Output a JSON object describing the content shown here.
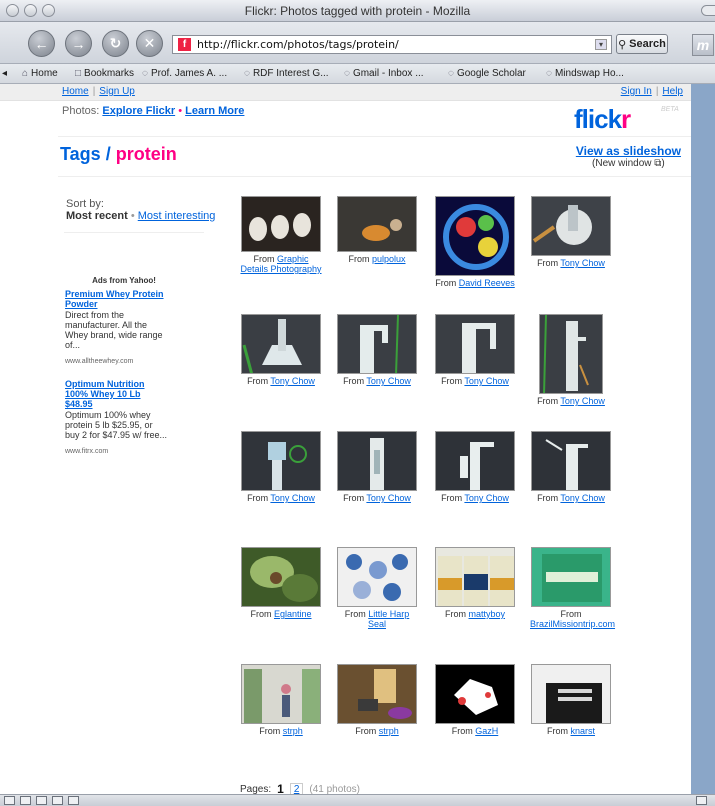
{
  "window": {
    "title": "Flickr: Photos tagged with protein - Mozilla"
  },
  "toolbar": {
    "url": "http://flickr.com/photos/tags/protein/",
    "search_label": "Search",
    "icons": [
      "back-icon",
      "forward-icon",
      "reload-icon",
      "stop-icon"
    ]
  },
  "bookmarks": [
    {
      "label": "Home",
      "icon": "house-icon"
    },
    {
      "label": "Bookmarks",
      "icon": "folder-icon"
    },
    {
      "label": "Prof. James A. ...",
      "icon": "bookmark-icon"
    },
    {
      "label": "RDF Interest G...",
      "icon": "bookmark-icon"
    },
    {
      "label": "Gmail - Inbox ...",
      "icon": "bookmark-icon"
    },
    {
      "label": "Google Scholar",
      "icon": "bookmark-icon"
    },
    {
      "label": "Mindswap Ho...",
      "icon": "bookmark-icon"
    }
  ],
  "topnav": {
    "home": "Home",
    "signup": "Sign Up",
    "signin": "Sign In",
    "help": "Help"
  },
  "subnav": {
    "prefix": "Photos:",
    "explore": "Explore Flickr",
    "dot": "•",
    "learn": "Learn More"
  },
  "logo": {
    "blue": "flick",
    "pink": "r",
    "beta": "BETA"
  },
  "title": {
    "tags": "Tags",
    "slash": "/",
    "tag": "protein"
  },
  "slideshow": {
    "label": "View as slideshow",
    "new_window": "(New window ⧉)"
  },
  "sort": {
    "label": "Sort by:",
    "current": "Most recent",
    "dot": "•",
    "alt": "Most interesting"
  },
  "ads": {
    "header": "Ads from Yahoo!",
    "items": [
      {
        "title": "Premium Whey Protein Powder",
        "desc": "Direct from the manufacturer. All the Whey brand, wide range of...",
        "url": "www.alltheewhey.com"
      },
      {
        "title": "Optimum Nutrition 100% Whey 10 Lb $48.95",
        "desc": "Optimum 100% whey protein 5 lb $25.95, or buy 2 for $47.95 w/ free...",
        "url": "www.fitrx.com"
      }
    ]
  },
  "photos": [
    {
      "from": "From",
      "author": "Graphic Details Photography",
      "colors": [
        "#2a2420",
        "#e8e4dc"
      ]
    },
    {
      "from": "From",
      "author": "pulpolux",
      "colors": [
        "#3a3834",
        "#d88a30"
      ]
    },
    {
      "from": "From",
      "author": "David Reeves",
      "colors": [
        "#0a0a3a",
        "#e8d23a"
      ]
    },
    {
      "from": "From",
      "author": "Tony Chow",
      "colors": [
        "#3e4248",
        "#e0e4e4"
      ]
    },
    {
      "from": "From",
      "author": "Tony Chow",
      "colors": [
        "#3a3e44",
        "#dfe8ea"
      ]
    },
    {
      "from": "From",
      "author": "Tony Chow",
      "colors": [
        "#3a3e44",
        "#e4ecec"
      ]
    },
    {
      "from": "From",
      "author": "Tony Chow",
      "colors": [
        "#3a3e44",
        "#e6ecec"
      ]
    },
    {
      "from": "From",
      "author": "Tony Chow",
      "colors": [
        "#3a3e44",
        "#e0e6e6"
      ]
    },
    {
      "from": "From",
      "author": "Tony Chow",
      "colors": [
        "#30343a",
        "#d8e2e6"
      ]
    },
    {
      "from": "From",
      "author": "Tony Chow",
      "colors": [
        "#30343a",
        "#e4eaea"
      ]
    },
    {
      "from": "From",
      "author": "Tony Chow",
      "colors": [
        "#2e3238",
        "#e8eeee"
      ]
    },
    {
      "from": "From",
      "author": "Tony Chow",
      "colors": [
        "#2e3238",
        "#e6ecec"
      ]
    },
    {
      "from": "From",
      "author": "Eglantine",
      "colors": [
        "#3e5a28",
        "#9ab86a"
      ]
    },
    {
      "from": "From",
      "author": "Little Harp Seal",
      "colors": [
        "#f0f0f0",
        "#3a6ab0"
      ]
    },
    {
      "from": "From",
      "author": "mattyboy",
      "colors": [
        "#1a3a6a",
        "#e8e4c8"
      ]
    },
    {
      "from": "From",
      "author": "BrazilMissiontrip.com",
      "colors": [
        "#3ab48a",
        "#e0f0d8"
      ]
    },
    {
      "from": "From",
      "author": "strph",
      "colors": [
        "#d8d8d0",
        "#7a9a6a"
      ]
    },
    {
      "from": "From",
      "author": "strph",
      "colors": [
        "#6a5030",
        "#e0c080"
      ]
    },
    {
      "from": "From",
      "author": "GazH",
      "colors": [
        "#000000",
        "#ffffff"
      ]
    },
    {
      "from": "From",
      "author": "knarst",
      "colors": [
        "#f0f0f0",
        "#1a1a1a"
      ]
    }
  ],
  "pagination": {
    "label": "Pages:",
    "current": "1",
    "next": "2",
    "count": "(41 photos)"
  }
}
